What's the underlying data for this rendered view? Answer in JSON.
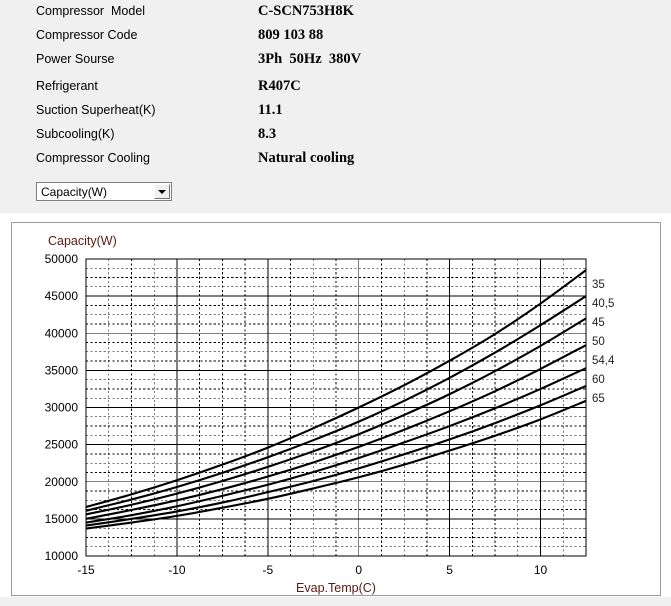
{
  "spec": {
    "rows": [
      {
        "label": "Compressor  Model",
        "value": "C-SCN753H8K"
      },
      {
        "label": "Compressor Code",
        "value": "809 103 88"
      },
      {
        "label": "Power Sourse",
        "value": "3Ph  50Hz  380V"
      },
      {
        "label": "Refrigerant",
        "value": "R407C"
      },
      {
        "label": "Suction Superheat(K)",
        "value": "11.1"
      },
      {
        "label": "Subcooling(K)",
        "value": "8.3"
      },
      {
        "label": "Compressor Cooling",
        "value": "Natural cooling"
      }
    ]
  },
  "parameter_select": {
    "selected": "Capacity(W)",
    "arrow_icon": "chevron-down-icon",
    "options": [
      "Capacity(W)"
    ]
  },
  "legend": {
    "title": "",
    "entries": [
      "35",
      "40,5",
      "45",
      "50",
      "54,4",
      "60",
      "65"
    ]
  },
  "chart_data": {
    "type": "line",
    "title": "",
    "xlabel": "Evap.Temp(C)",
    "ylabel": "Capacity(W)",
    "xlim": [
      -15,
      12.5
    ],
    "ylim": [
      10000,
      50000
    ],
    "xticks": [
      -15,
      -10,
      -5,
      0,
      5,
      10
    ],
    "yticks": [
      10000,
      15000,
      20000,
      25000,
      30000,
      35000,
      40000,
      45000,
      50000
    ],
    "xtick_labels": [
      "-15",
      "-10",
      "-5",
      "0",
      "5",
      "10"
    ],
    "ytick_labels": [
      "10000",
      "15000",
      "20000",
      "25000",
      "30000",
      "35000",
      "40000",
      "45000",
      "50000"
    ],
    "grid": true,
    "minor_grid": true,
    "minor_divisions": 4,
    "legend_position": "right",
    "line_color": "#000000",
    "series": [
      {
        "name": "35",
        "x": [
          -15,
          -12.5,
          -10,
          -7.5,
          -5,
          -2.5,
          0,
          2.5,
          5,
          7.5,
          10,
          12.5
        ],
        "values": [
          16600,
          18300,
          20200,
          22300,
          24600,
          27200,
          30000,
          33000,
          36300,
          39900,
          44000,
          48500
        ]
      },
      {
        "name": "40,5",
        "x": [
          -15,
          -12.5,
          -10,
          -7.5,
          -5,
          -2.5,
          0,
          2.5,
          5,
          7.5,
          10,
          12.5
        ],
        "values": [
          16100,
          17600,
          19300,
          21200,
          23300,
          25600,
          28100,
          30900,
          34000,
          37400,
          41100,
          45000
        ]
      },
      {
        "name": "45",
        "x": [
          -15,
          -12.5,
          -10,
          -7.5,
          -5,
          -2.5,
          0,
          2.5,
          5,
          7.5,
          10,
          12.5
        ],
        "values": [
          15600,
          16900,
          18400,
          20100,
          22000,
          24100,
          26400,
          29000,
          31800,
          34900,
          38300,
          42000
        ]
      },
      {
        "name": "50",
        "x": [
          -15,
          -12.5,
          -10,
          -7.5,
          -5,
          -2.5,
          0,
          2.5,
          5,
          7.5,
          10,
          12.5
        ],
        "values": [
          15000,
          16200,
          17500,
          19000,
          20700,
          22600,
          24700,
          27000,
          29500,
          32200,
          35200,
          38400
        ]
      },
      {
        "name": "54,4",
        "x": [
          -15,
          -12.5,
          -10,
          -7.5,
          -5,
          -2.5,
          0,
          2.5,
          5,
          7.5,
          10,
          12.5
        ],
        "values": [
          14500,
          15500,
          16700,
          18100,
          19600,
          21300,
          23200,
          25300,
          27500,
          29900,
          32500,
          35300
        ]
      },
      {
        "name": "60",
        "x": [
          -15,
          -12.5,
          -10,
          -7.5,
          -5,
          -2.5,
          0,
          2.5,
          5,
          7.5,
          10,
          12.5
        ],
        "values": [
          14100,
          15000,
          16000,
          17200,
          18600,
          20100,
          21800,
          23700,
          25700,
          27900,
          30300,
          32900
        ]
      },
      {
        "name": "65",
        "x": [
          -15,
          -12.5,
          -10,
          -7.5,
          -5,
          -2.5,
          0,
          2.5,
          5,
          7.5,
          10,
          12.5
        ],
        "values": [
          13700,
          14500,
          15400,
          16500,
          17700,
          19100,
          20600,
          22300,
          24200,
          26200,
          28400,
          30900
        ]
      }
    ]
  }
}
